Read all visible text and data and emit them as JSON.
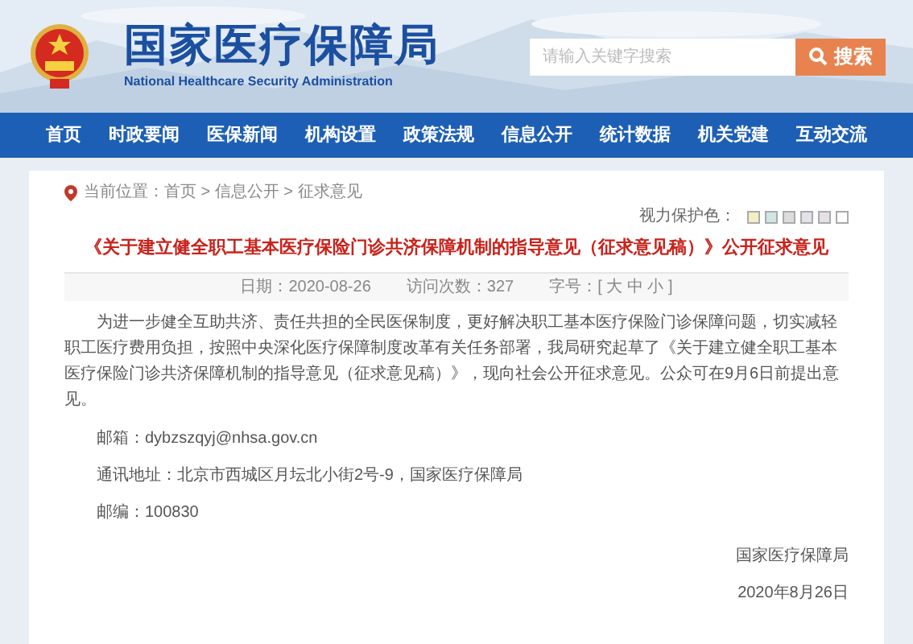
{
  "header": {
    "title": "国家医疗保障局",
    "subtitle": "National Healthcare Security Administration",
    "search": {
      "placeholder": "请输入关键字搜索",
      "button": "搜索"
    }
  },
  "nav": [
    "首页",
    "时政要闻",
    "医保新闻",
    "机构设置",
    "政策法规",
    "信息公开",
    "统计数据",
    "机关党建",
    "互动交流"
  ],
  "breadcrumb": {
    "label": "当前位置：",
    "items": [
      "首页",
      "信息公开",
      "征求意见"
    ],
    "separator": ">"
  },
  "eye_care": {
    "label": "视力保护色：",
    "swatches": [
      {
        "color": "#f3efc4"
      },
      {
        "color": "#cfe6e3"
      },
      {
        "color": "#dcdcdc"
      },
      {
        "color": "#e2e2ea"
      },
      {
        "color": "#e6e0e6"
      },
      {
        "color": "#ffffff"
      }
    ]
  },
  "article": {
    "title": "《关于建立健全职工基本医疗保险门诊共济保障机制的指导意见（征求意见稿）》公开征求意见",
    "meta": [
      "日期：2020-08-26",
      "访问次数：327",
      "字号：[ 大 中 小 ]"
    ],
    "body": "为进一步健全互助共济、责任共担的全民医保制度，更好解决职工基本医疗保险门诊保障问题，切实减轻职工医疗费用负担，按照中央深化医疗保障制度改革有关任务部署，我局研究起草了《关于建立健全职工基本医疗保险门诊共济保障机制的指导意见（征求意见稿）》，现向社会公开征求意见。公众可在9月6日前提出意见。",
    "contacts": [
      "邮箱：dybzszqyj@nhsa.gov.cn",
      "通讯地址：北京市西城区月坛北小街2号-9，国家医疗保障局",
      "邮编：100830"
    ],
    "signature": "国家医疗保障局",
    "date": "2020年8月26日"
  }
}
